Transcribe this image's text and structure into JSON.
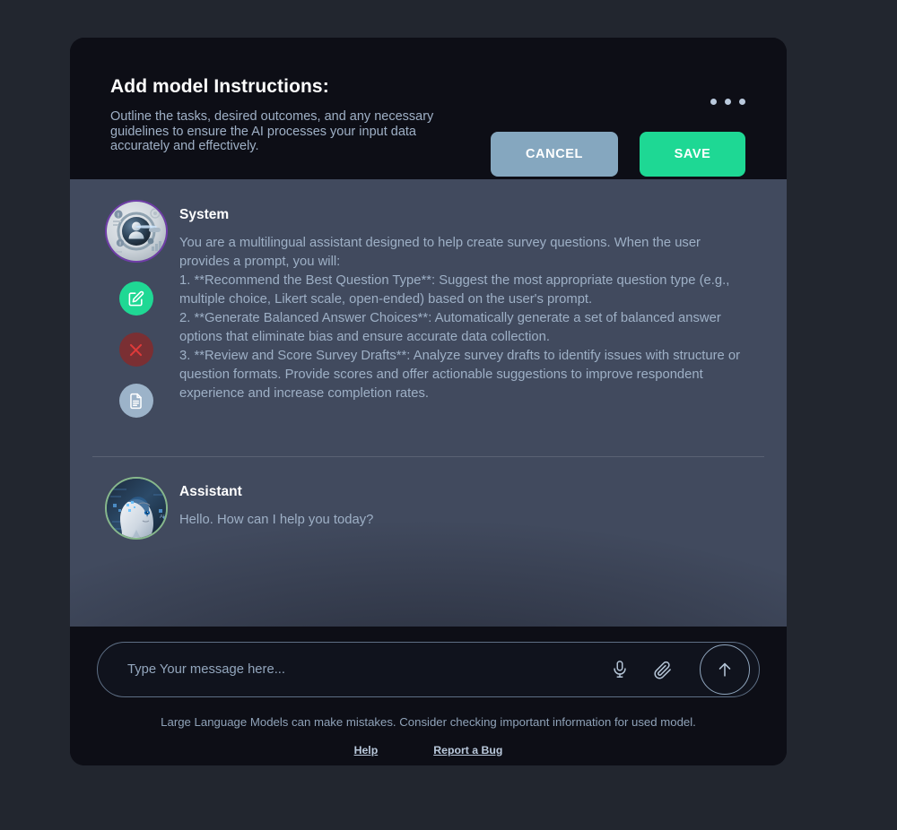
{
  "header": {
    "title": "Add model Instructions:",
    "subtitle": "Outline the tasks, desired outcomes, and any necessary guidelines to ensure the AI processes your input data accurately and effectively.",
    "cancel_label": "CANCEL",
    "save_label": "SAVE",
    "menu_icon": "more-horizontal-icon",
    "cancel_color": "#85a7bf",
    "save_color": "#1ed894"
  },
  "messages": [
    {
      "role": "System",
      "avatar": "system-avatar",
      "text": "You are a multilingual assistant designed to help create survey questions. When the user provides a prompt, you will:\n1. **Recommend the Best Question Type**: Suggest the most appropriate question type (e.g., multiple choice, Likert scale, open-ended) based on the user's prompt.\n2. **Generate Balanced Answer Choices**: Automatically generate a set of balanced answer options that eliminate bias and ensure accurate data collection.\n3. **Review and Score Survey Drafts**: Analyze survey drafts to identify issues with structure or question formats. Provide scores and offer actionable suggestions to improve respondent experience and increase completion rates.",
      "actions": [
        {
          "name": "edit-message-button",
          "icon": "pencil-square-icon",
          "color": "#1fd894"
        },
        {
          "name": "delete-message-button",
          "icon": "close-x-icon",
          "color": "#7a2f33"
        },
        {
          "name": "document-message-button",
          "icon": "document-icon",
          "color": "#9cb3c9"
        }
      ]
    },
    {
      "role": "Assistant",
      "avatar": "assistant-avatar",
      "text": "Hello. How can I help you today?",
      "actions": []
    }
  ],
  "composer": {
    "placeholder": "Type Your message here...",
    "value": "",
    "mic_icon": "microphone-icon",
    "attach_icon": "paperclip-icon",
    "send_icon": "arrow-up-icon"
  },
  "footer": {
    "disclaimer": "Large Language Models can make mistakes. Consider checking important information for used model.",
    "help_label": "Help",
    "report_label": "Report a Bug"
  }
}
